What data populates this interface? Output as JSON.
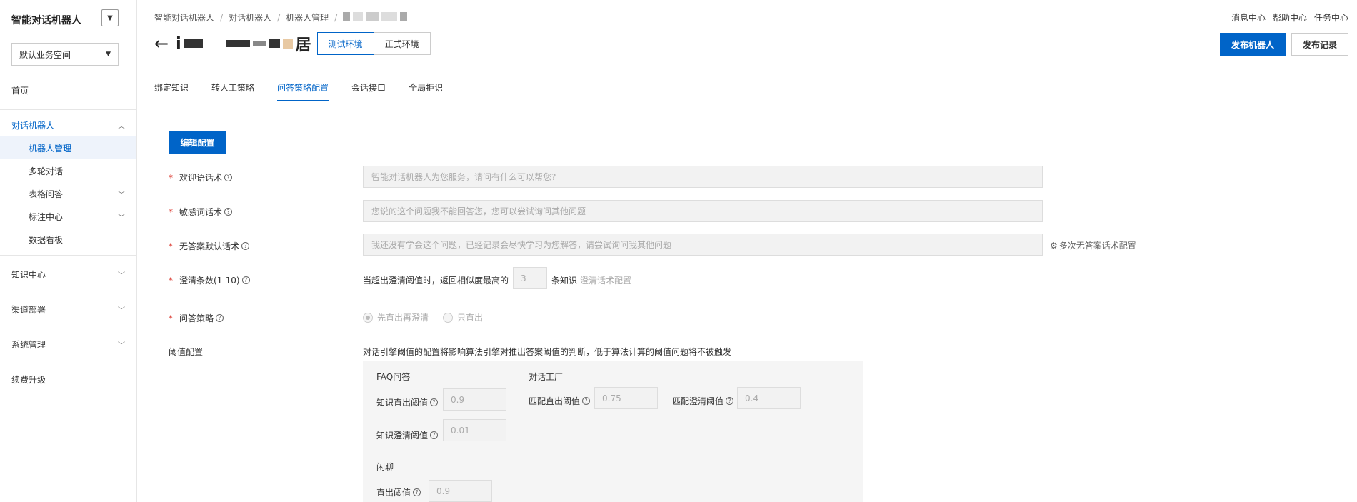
{
  "sidebar": {
    "app_title": "智能对话机器人",
    "workspace": "默认业务空间",
    "home": "首页",
    "group_dialog": "对话机器人",
    "items_dialog": [
      "机器人管理",
      "多轮对话",
      "表格问答",
      "标注中心",
      "数据看板"
    ],
    "knowledge": "知识中心",
    "channel": "渠道部署",
    "system": "系统管理",
    "renew": "续费升级"
  },
  "header": {
    "breadcrumb": [
      "智能对话机器人",
      "对话机器人",
      "机器人管理"
    ],
    "top_links": [
      "消息中心",
      "帮助中心",
      "任务中心"
    ],
    "robot_name_prefix": "i",
    "robot_name_suffix": "居",
    "env_test": "测试环境",
    "env_prod": "正式环境",
    "publish": "发布机器人",
    "publish_log": "发布记录"
  },
  "tabs": [
    "绑定知识",
    "转人工策略",
    "问答策略配置",
    "会话接口",
    "全局拒识"
  ],
  "form": {
    "edit_button": "编辑配置",
    "welcome_label": "欢迎语话术",
    "welcome_value": "智能对话机器人为您服务，请问有什么可以帮您?",
    "sensitive_label": "敏感词话术",
    "sensitive_value": "您说的这个问题我不能回答您，您可以尝试询问其他问题",
    "noanswer_label": "无答案默认话术",
    "noanswer_value": "我还没有学会这个问题，已经记录会尽快学习为您解答，请尝试询问我其他问题",
    "noanswer_link": "多次无答案话术配置",
    "clarify_label": "澄清条数(1-10)",
    "clarify_prefix": "当超出澄清阈值时，返回相似度最高的",
    "clarify_value": "3",
    "clarify_suffix": "条知识",
    "clarify_link": "澄清话术配置",
    "strategy_label": "问答策略",
    "strategy_opt1": "先直出再澄清",
    "strategy_opt2": "只直出",
    "threshold_label": "阈值配置",
    "threshold_desc": "对话引擎阈值的配置将影响算法引擎对推出答案阈值的判断，低于算法计算的阈值问题将不被触发",
    "faq_title": "FAQ问答",
    "faq_direct_label": "知识直出阈值",
    "faq_direct_value": "0.9",
    "faq_clarify_label": "知识澄清阈值",
    "faq_clarify_value": "0.01",
    "factory_title": "对话工厂",
    "factory_direct_label": "匹配直出阈值",
    "factory_direct_value": "0.75",
    "factory_clarify_label": "匹配澄清阈值",
    "factory_clarify_value": "0.4",
    "chat_title": "闲聊",
    "chat_direct_label": "直出阈值",
    "chat_direct_value": "0.9"
  }
}
